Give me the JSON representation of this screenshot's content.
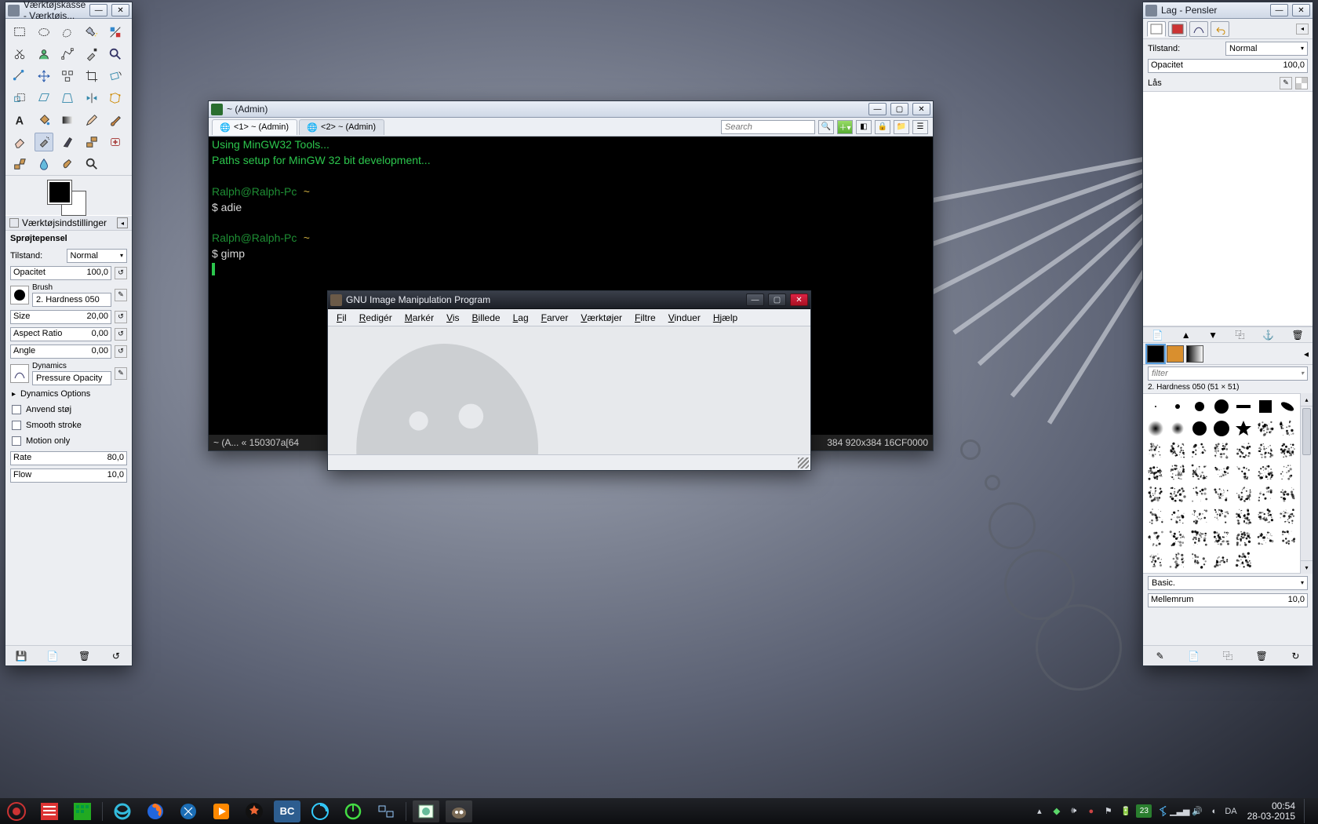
{
  "toolbox": {
    "title": "Værktøjskasse - Værktøjs...",
    "options_tab": "Værktøjsindstillinger",
    "section_title": "Sprøjtepensel",
    "tilstand_label": "Tilstand:",
    "tilstand_value": "Normal",
    "opacity_label": "Opacitet",
    "opacity_value": "100,0",
    "brush_label": "Brush",
    "brush_name": "2. Hardness 050",
    "size_label": "Size",
    "size_value": "20,00",
    "aspect_label": "Aspect Ratio",
    "aspect_value": "0,00",
    "angle_label": "Angle",
    "angle_value": "0,00",
    "dynamics_label": "Dynamics",
    "dynamics_name": "Pressure Opacity",
    "dynamics_options": "Dynamics Options",
    "apply_jitter": "Anvend støj",
    "smooth_stroke": "Smooth stroke",
    "motion_only": "Motion only",
    "rate_label": "Rate",
    "rate_value": "80,0",
    "flow_label": "Flow",
    "flow_value": "10,0"
  },
  "terminal": {
    "title": "~ (Admin)",
    "tab1": "<1> ~ (Admin)",
    "tab2": "<2> ~ (Admin)",
    "search_placeholder": "Search",
    "lines": [
      "Using MinGW32 Tools...",
      "Paths setup for MinGW 32 bit development...",
      "",
      "Ralph@Ralph-Pc ~",
      "$ adie",
      "",
      "Ralph@Ralph-Pc ~",
      "$ gimp"
    ],
    "status_left": "~ (A...  « 150307a[64",
    "status_right": "384 920x384 16CF0000"
  },
  "gimp": {
    "title": "GNU Image Manipulation Program",
    "menu": [
      "Fil",
      "Redigér",
      "Markér",
      "Vis",
      "Billede",
      "Lag",
      "Farver",
      "Værktøjer",
      "Filtre",
      "Vinduer",
      "Hjælp"
    ]
  },
  "dock": {
    "title": "Lag - Pensler",
    "tilstand_label": "Tilstand:",
    "tilstand_value": "Normal",
    "opacity_label": "Opacitet",
    "opacity_value": "100,0",
    "lock_label": "Lås",
    "filter_placeholder": "filter",
    "current_brush": "2. Hardness 050 (51 × 51)",
    "basic_label": "Basic.",
    "spacing_label": "Mellemrum",
    "spacing_value": "10,0"
  },
  "tray": {
    "language": "DA",
    "time": "00:54",
    "date": "28-03-2015"
  }
}
